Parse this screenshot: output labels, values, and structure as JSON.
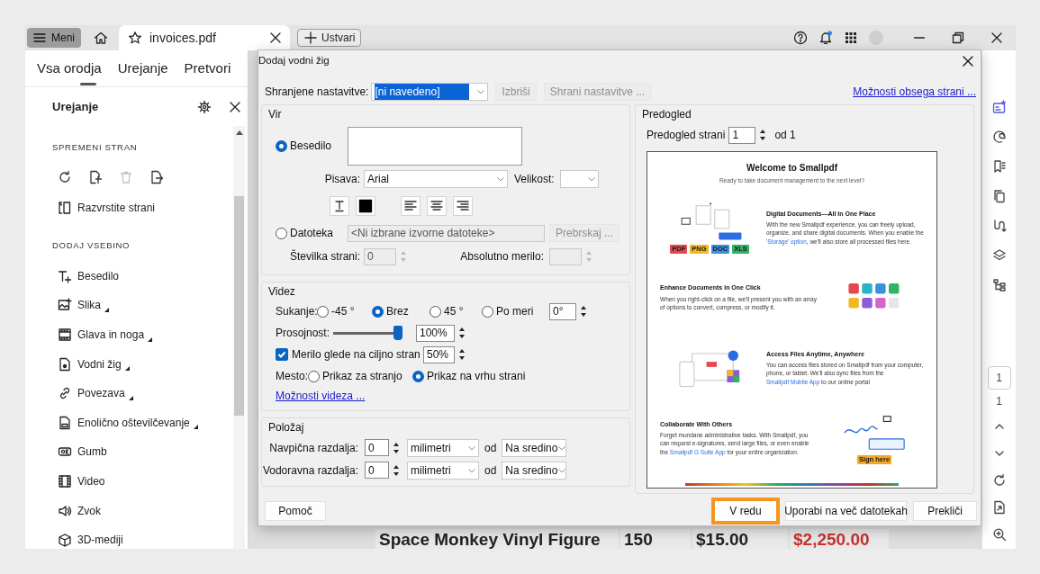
{
  "app_bar": {
    "menu_button": "Meni",
    "tab_title": "invoices.pdf",
    "create_button": "Ustvari"
  },
  "top_tabs": [
    {
      "label": "Vsa orodja",
      "selected": true
    },
    {
      "label": "Urejanje",
      "selected": false
    },
    {
      "label": "Pretvori",
      "selected": false
    }
  ],
  "panel": {
    "title": "Urejanje",
    "sections": [
      {
        "heading": "SPREMENI STRAN",
        "tools": [
          {
            "kind": "rotate",
            "disabled": false
          },
          {
            "kind": "crop",
            "disabled": false
          },
          {
            "kind": "delete",
            "disabled": true
          },
          {
            "kind": "extract",
            "disabled": false
          }
        ],
        "items": [
          {
            "kind": "reorder",
            "label": "Razvrstite strani",
            "submenu": false
          }
        ]
      },
      {
        "heading": "DODAJ VSEBINO",
        "items": [
          {
            "kind": "text",
            "label": "Besedilo",
            "submenu": false
          },
          {
            "kind": "image",
            "label": "Slika",
            "submenu": true
          },
          {
            "kind": "header_footer",
            "label": "Glava in noga",
            "submenu": true
          },
          {
            "kind": "watermark",
            "label": "Vodni žig",
            "submenu": true
          },
          {
            "kind": "link",
            "label": "Povezava",
            "submenu": true
          },
          {
            "kind": "numbering",
            "label": "Enolično oštevilčevanje",
            "submenu": true
          },
          {
            "kind": "button",
            "label": "Gumb",
            "submenu": false
          },
          {
            "kind": "video",
            "label": "Video",
            "submenu": false
          },
          {
            "kind": "sound",
            "label": "Zvok",
            "submenu": false
          },
          {
            "kind": "cube",
            "label": "3D-mediji",
            "submenu": false
          }
        ]
      }
    ]
  },
  "document": {
    "row": [
      "Space Monkey Vinyl Figure",
      "150",
      "$15.00",
      "$2,250.00"
    ]
  },
  "right_toolbar": {
    "tools": [
      {
        "kind": "edit_panel"
      },
      {
        "kind": "comment"
      },
      {
        "kind": "bookmark"
      },
      {
        "kind": "pages"
      },
      {
        "kind": "connector"
      },
      {
        "kind": "layers"
      },
      {
        "kind": "tree"
      }
    ],
    "page_field": "1",
    "page_count": "1",
    "bottom_tools": [
      {
        "kind": "chevron_up"
      },
      {
        "kind": "chevron_down"
      },
      {
        "kind": "rotate"
      },
      {
        "kind": "export_doc"
      },
      {
        "kind": "zoom"
      }
    ]
  },
  "dialog": {
    "title": "Dodaj vodni žig",
    "saved_settings": {
      "label": "Shranjene nastavitve:",
      "value": "[ni navedeno]",
      "highlighted": true,
      "delete_button": {
        "label": "Izbriši",
        "disabled": true
      },
      "save_button": {
        "label": "Shrani nastavitve ...",
        "disabled": true
      },
      "page_range_link": "Možnosti obsega strani ..."
    },
    "source": {
      "title": "Vir",
      "options": [
        {
          "label": "Besedilo",
          "selected": true
        },
        {
          "label": "Datoteka",
          "selected": false
        }
      ],
      "font_label": "Pisava:",
      "font_value": "Arial",
      "size_label": "Velikost:",
      "format_tools": [
        {
          "kind": "underline"
        },
        {
          "kind": "color"
        },
        {
          "kind": "align_left"
        },
        {
          "kind": "align_center"
        },
        {
          "kind": "align_right"
        }
      ],
      "file_field": {
        "value": "<Ni izbrane izvorne datoteke>",
        "disabled": true
      },
      "browse_button": {
        "label": "Prebrskaj ...",
        "disabled": true
      },
      "page_number": {
        "label": "Številka strani:",
        "value": "0",
        "disabled": true
      },
      "absolute_scale": {
        "label": "Absolutno merilo:",
        "disabled": true
      }
    },
    "appearance": {
      "title": "Videz",
      "rotation_label": "Sukanje:",
      "rotations": [
        {
          "label": "-45 °",
          "selected": false
        },
        {
          "label": "Brez",
          "selected": true
        },
        {
          "label": "45 °",
          "selected": false
        },
        {
          "label": "Po meri",
          "selected": false
        }
      ],
      "custom_rotation": "0°",
      "opacity_label": "Prosojnost:",
      "opacity": {
        "level": 1
      },
      "opacity_value": "100%",
      "scale": {
        "label": "Merilo glede na ciljno stran",
        "checked": true,
        "value": "50%"
      },
      "location_label": "Mesto:",
      "locations": [
        {
          "label": "Prikaz za stranjo",
          "selected": false
        },
        {
          "label": "Prikaz na vrhu strani",
          "selected": true
        }
      ],
      "options_link": "Možnosti videza ..."
    },
    "position": {
      "title": "Položaj",
      "rows": [
        {
          "label": "Navpična razdalja:",
          "value": "0",
          "unit": "milimetri",
          "from_label": "od",
          "anchor": "Na sredino"
        },
        {
          "label": "Vodoravna razdalja:",
          "value": "0",
          "unit": "milimetri",
          "from_label": "od",
          "anchor": "Na sredino"
        }
      ]
    },
    "preview": {
      "title": "Predogled",
      "page_label": "Predogled strani",
      "page_value": "1",
      "page_of": "od 1",
      "page": {
        "title": "Welcome to Smallpdf",
        "subtitle": "Ready to take document management to the next level?",
        "sections": [
          {
            "kind": "files",
            "heading": "Digital Documents—All In One Place",
            "body": [
              {
                "text": "With the new Smallpdf experience, you can freely upload, organize, and share digital documents. When you enable the ",
                "link": false
              },
              {
                "text": "'Storage' option",
                "link": true
              },
              {
                "text": ", we'll also store all processed files here.",
                "link": false
              }
            ],
            "labels": [
              {
                "text": "PDF",
                "color": "#e5484d"
              },
              {
                "text": "PNG",
                "color": "#f2b824"
              },
              {
                "text": "DOC",
                "color": "#3d8fe0"
              },
              {
                "text": "XLS",
                "color": "#2fb463"
              }
            ]
          },
          {
            "kind": "apps",
            "heading": "Enhance Documents in One Click",
            "body": [
              {
                "text": "When you right-click on a file, we'll present you with an array of options to convert, compress, or modify it.",
                "link": false
              }
            ]
          },
          {
            "kind": "devices",
            "heading": "Access Files Anytime, Anywhere",
            "body": [
              {
                "text": "You can access files stored on Smallpdf from your computer, phone, or tablet. We'll also sync files from the ",
                "link": false
              },
              {
                "text": "Smallpdf Mobile App",
                "link": true
              },
              {
                "text": " to our online portal",
                "link": false
              }
            ]
          },
          {
            "kind": "signature",
            "heading": "Collaborate With Others",
            "body": [
              {
                "text": "Forget mundane administrative tasks. With Smallpdf, you can request e-signatures, send large files, or even enable the ",
                "link": false
              },
              {
                "text": "Smallpdf G Suite App",
                "link": true
              },
              {
                "text": " for your entire organization.",
                "link": false
              }
            ],
            "labels": [
              {
                "text": "Sign here",
                "color": "#f5a623"
              }
            ]
          }
        ]
      }
    },
    "buttons": [
      {
        "label": "Pomoč",
        "highlighted": false
      },
      {
        "label": "V redu",
        "highlighted": true
      },
      {
        "label": "Uporabi na več datotekah",
        "highlighted": false
      },
      {
        "label": "Prekliči",
        "highlighted": false
      }
    ]
  }
}
